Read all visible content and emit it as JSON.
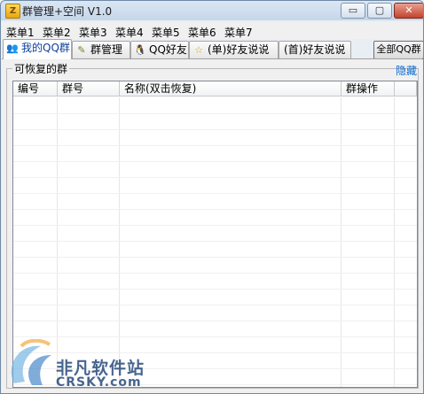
{
  "window": {
    "title": "群管理+空间 V1.0",
    "icon_label": "Z",
    "controls": {
      "minimize": "▭",
      "maximize": "▢",
      "close": "✕"
    }
  },
  "menu": [
    "菜单1",
    "菜单2",
    "菜单3",
    "菜单4",
    "菜单5",
    "菜单6",
    "菜单7"
  ],
  "tabs": [
    {
      "label": "我的QQ群",
      "icon": "people-icon",
      "glyph": "👥",
      "active": true
    },
    {
      "label": "群管理",
      "icon": "pencil-icon",
      "glyph": "✎",
      "active": false
    },
    {
      "label": "QQ好友",
      "icon": "penguin-icon",
      "glyph": "🐧",
      "active": false
    },
    {
      "label": "(单)好友说说",
      "icon": "star-icon",
      "glyph": "☆",
      "active": false
    },
    {
      "label": "(首)好友说说",
      "icon": "",
      "glyph": "",
      "active": false
    }
  ],
  "all_qq_button": "全部QQ群",
  "group_panel": {
    "title": "可恢复的群",
    "hide_link": "隐藏",
    "columns": [
      "编号",
      "群号",
      "名称(双击恢复)",
      "群操作"
    ]
  },
  "watermark": {
    "line1": "非凡软件站",
    "line2": "CRSKY.com"
  },
  "colors": {
    "link": "#0a6cd6",
    "title_bar": "#c5d6ea",
    "close_button": "#c2432d",
    "watermark": "#1a3f73"
  }
}
